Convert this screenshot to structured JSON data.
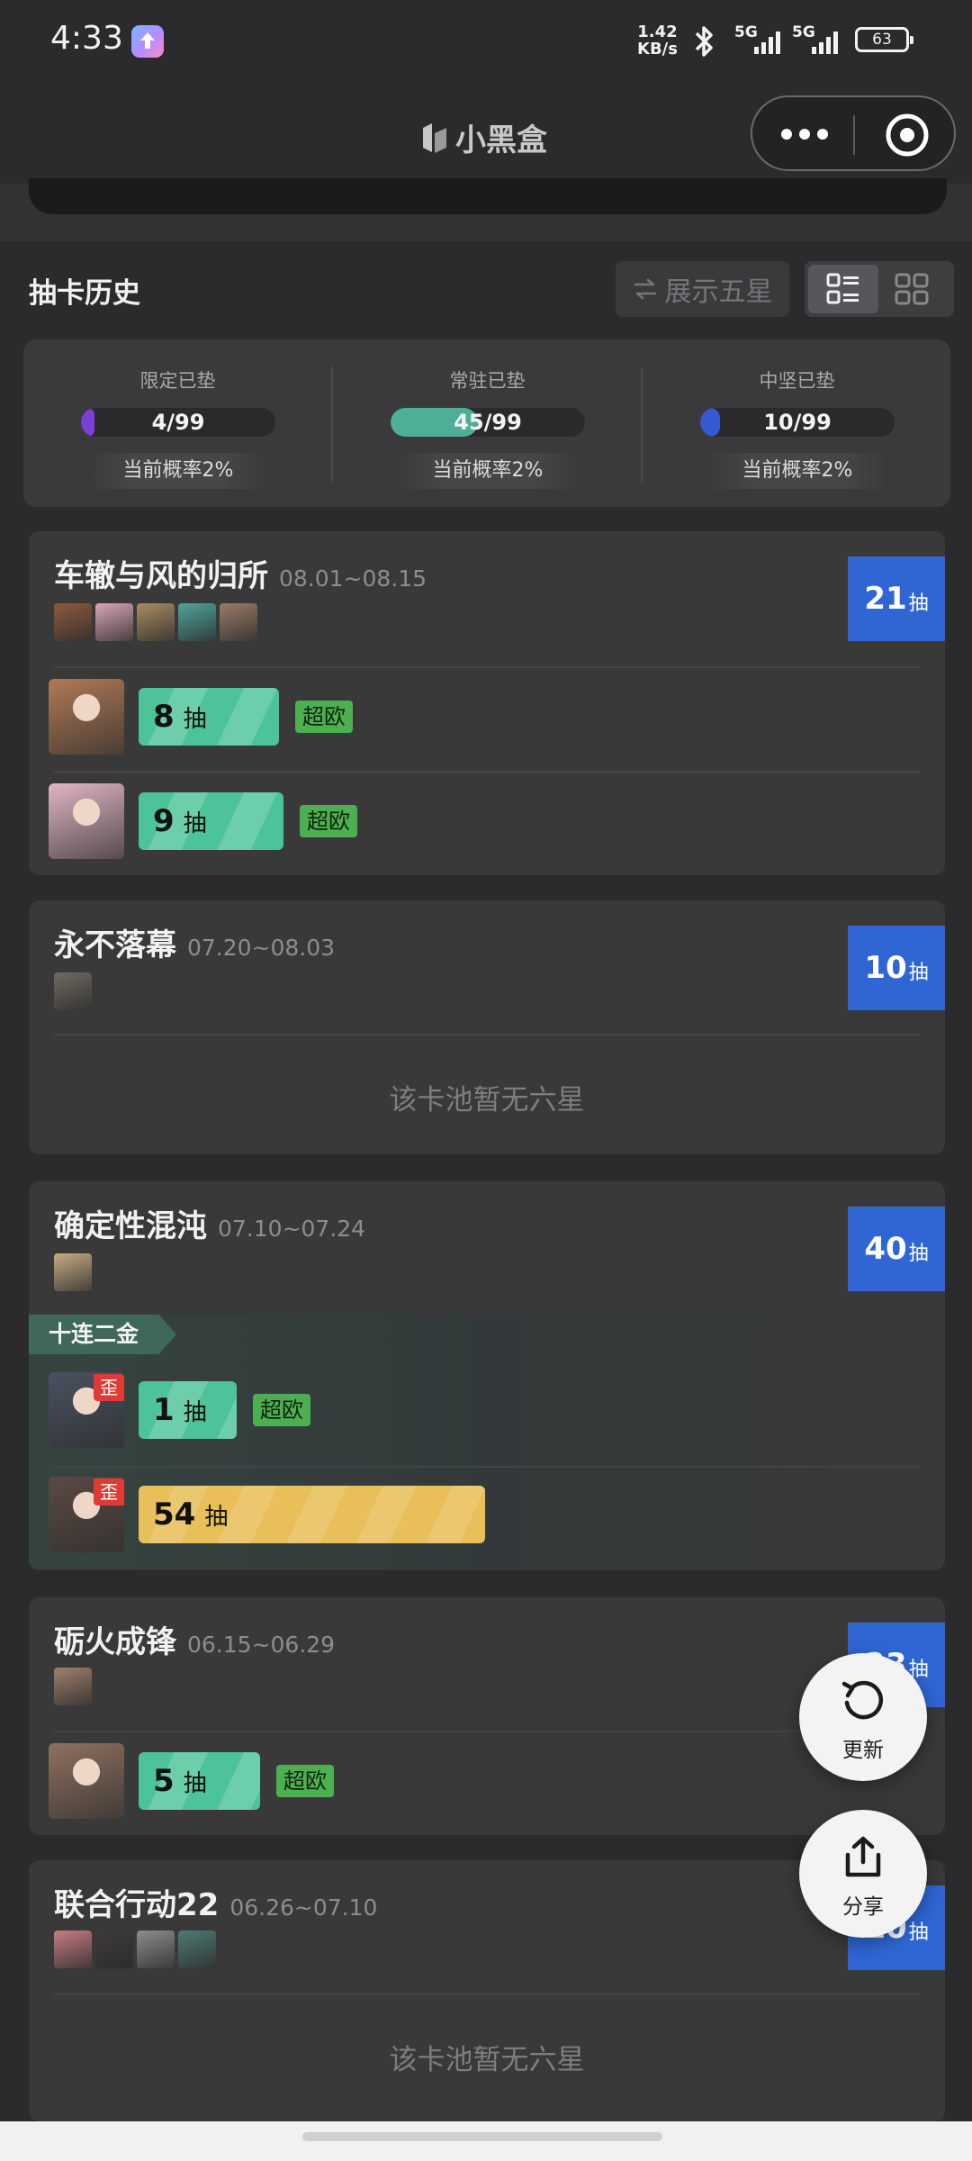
{
  "status_bar": {
    "time": "4:33",
    "net_speed_value": "1.42",
    "net_speed_unit": "KB/s",
    "signal1": "5G",
    "signal2": "5G",
    "battery": "63"
  },
  "titlebar": {
    "brand": "小黑盒"
  },
  "history": {
    "title": "抽卡历史",
    "show_five_star_label": "展示五星"
  },
  "stats": [
    {
      "label": "限定已垫",
      "value": "4/99",
      "progress": 0.04,
      "color": "#7a3fd6",
      "rate": "当前概率2%"
    },
    {
      "label": "常驻已垫",
      "value": "45/99",
      "progress": 0.45,
      "color": "#4fae97",
      "rate": "当前概率2%"
    },
    {
      "label": "中坚已垫",
      "value": "10/99",
      "progress": 0.1,
      "color": "#3559d0",
      "rate": "当前概率2%"
    }
  ],
  "pools": [
    {
      "name": "车辙与风的归所",
      "date": "08.01~08.15",
      "pulls": "21",
      "pull_unit": "抽",
      "avatar_colors": [
        "#8d5a3e",
        "#d9a6b5",
        "#a88d62",
        "#4fa59a",
        "#9a7b67"
      ],
      "rows": [
        {
          "count": "8",
          "unit": "抽",
          "progress": 0.1,
          "lucky": "超欧",
          "gold": false,
          "off": "",
          "avatar": "#b07a55"
        },
        {
          "count": "9",
          "unit": "抽",
          "progress": 0.11,
          "lucky": "超欧",
          "gold": false,
          "off": "",
          "avatar": "#e2b6c4"
        }
      ]
    },
    {
      "name": "永不落幕",
      "date": "07.20~08.03",
      "pulls": "10",
      "pull_unit": "抽",
      "avatar_colors": [
        "#6f6a62"
      ],
      "empty": "该卡池暂无六星"
    },
    {
      "name": "确定性混沌",
      "date": "07.10~07.24",
      "pulls": "40",
      "pull_unit": "抽",
      "avatar_colors": [
        "#c9ab85"
      ],
      "ten_label": "十连二金",
      "rows": [
        {
          "count": "1",
          "unit": "抽",
          "progress": 0.01,
          "lucky": "超欧",
          "gold": false,
          "off": "歪",
          "avatar": "#4a5160"
        },
        {
          "count": "54",
          "unit": "抽",
          "progress": 0.54,
          "lucky": "",
          "gold": true,
          "off": "歪",
          "avatar": "#5a4a44"
        }
      ]
    },
    {
      "name": "砺火成锋",
      "date": "06.15~06.29",
      "pulls": "23",
      "pull_unit": "抽",
      "avatar_colors": [
        "#a0806d"
      ],
      "rows": [
        {
          "count": "5",
          "unit": "抽",
          "progress": 0.06,
          "lucky": "超欧",
          "gold": false,
          "off": "",
          "avatar": "#8e7160"
        }
      ]
    },
    {
      "name": "联合行动22",
      "date": "06.26~07.10",
      "pulls": "10",
      "pull_unit": "抽",
      "avatar_colors": [
        "#c77c84",
        "#3e3a3c",
        "#8d8d8d",
        "#4f7a73"
      ],
      "empty": "该卡池暂无六星"
    }
  ],
  "fab": {
    "refresh_label": "更新",
    "share_label": "分享"
  },
  "colors": {
    "accent_blue": "#2f66d3",
    "pull_green": "#4cc398",
    "pull_gold": "#e8bf59",
    "lucky_green": "#4db050",
    "off_red": "#de3b36"
  }
}
